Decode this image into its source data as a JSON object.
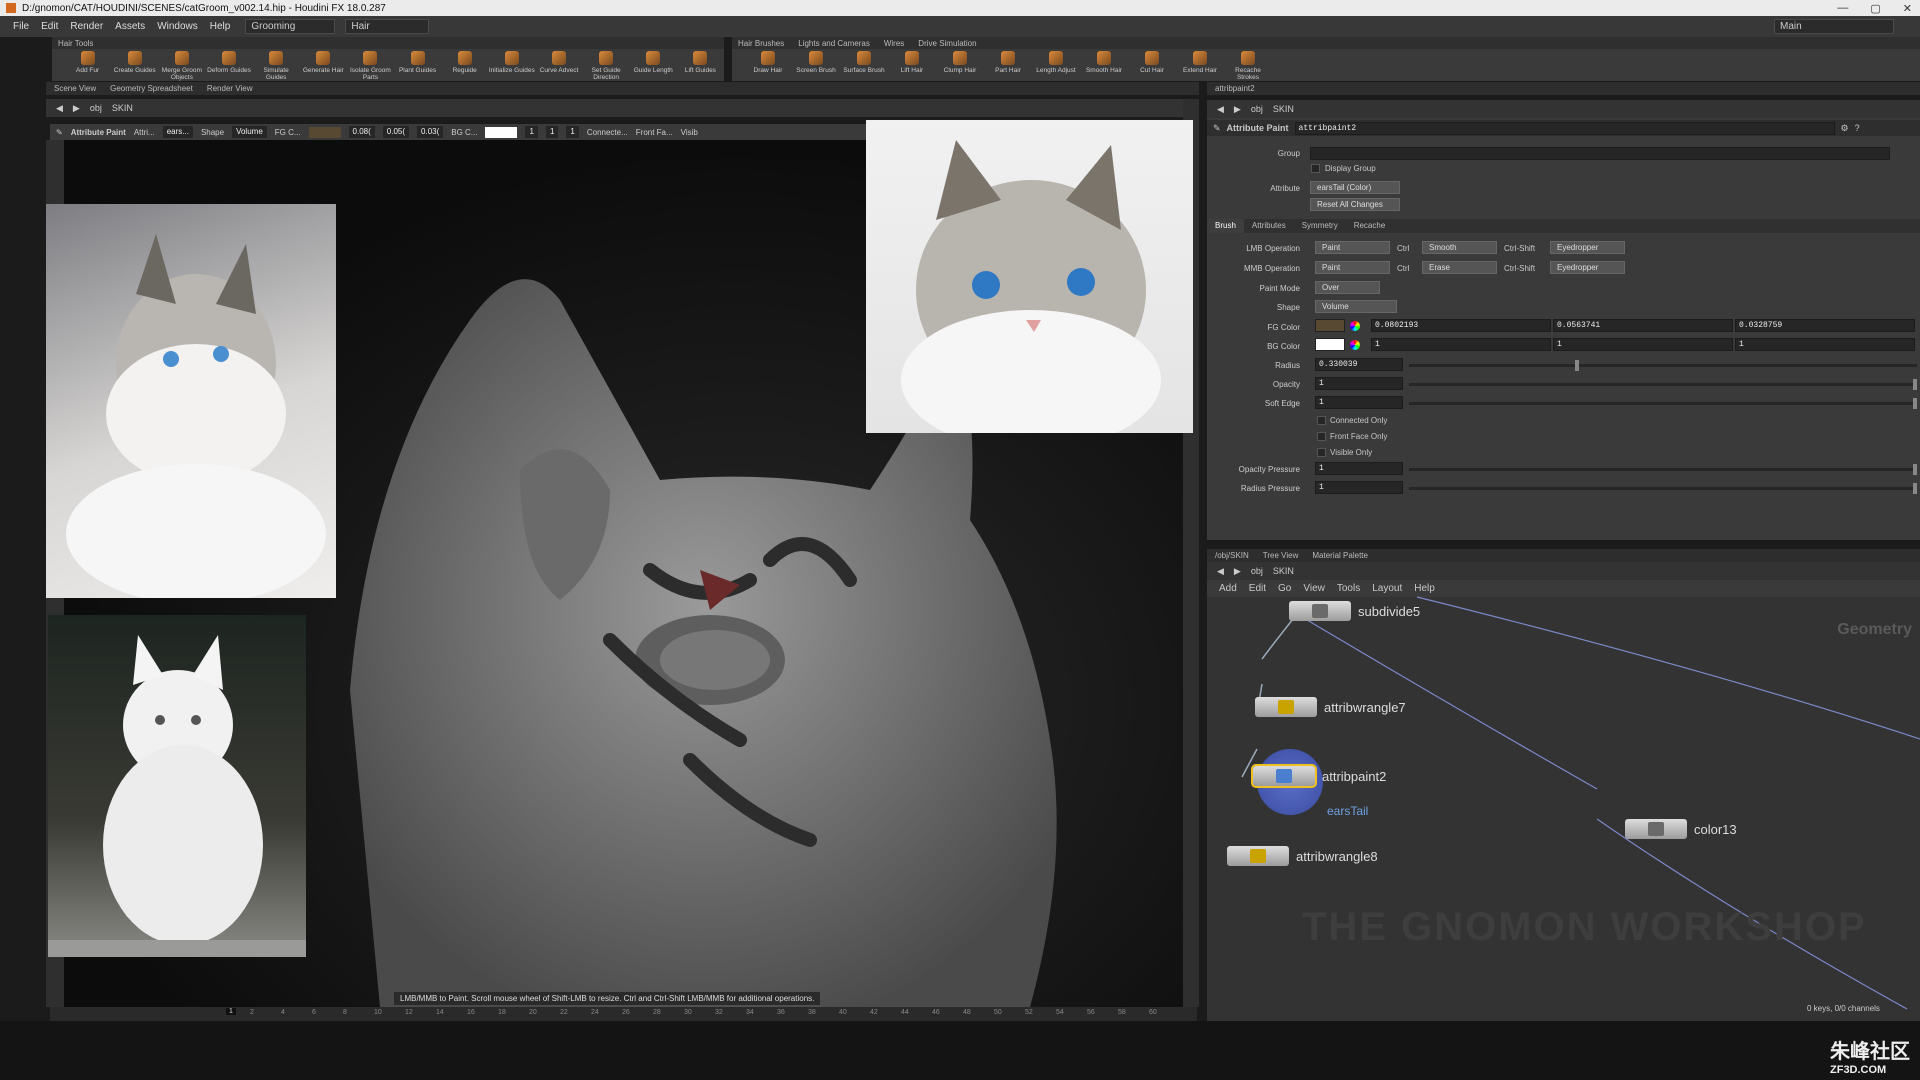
{
  "title_bar": {
    "text": "D:/gnomon/CAT/HOUDINI/SCENES/catGroom_v002.14.hip - Houdini FX 18.0.287",
    "controls": [
      "—",
      "▢",
      "✕"
    ]
  },
  "menu": {
    "items": [
      "File",
      "Edit",
      "Render",
      "Assets",
      "Windows",
      "Help"
    ],
    "desktop": "Grooming",
    "context": "Hair",
    "workspace": "Main"
  },
  "shelf_left": {
    "header": "Hair Tools",
    "tools": [
      "Add Fur",
      "Create Guides",
      "Merge Groom Objects",
      "Deform Guides",
      "Simulate Guides",
      "Generate Hair",
      "Isolate Groom Parts",
      "Plant Guides",
      "Reguide",
      "Initialize Guides",
      "Curve Advect",
      "Set Guide Direction",
      "Guide Length",
      "Lift Guides"
    ]
  },
  "shelf_right": {
    "tabs": [
      "Hair Brushes",
      "Lights and Cameras",
      "Wires",
      "Drive Simulation"
    ],
    "tools": [
      "Draw Hair",
      "Screen Brush",
      "Surface Brush",
      "Lift Hair",
      "Clump Hair",
      "Part Hair",
      "Length Adjust",
      "Smooth Hair",
      "Cut Hair",
      "Extend Hair",
      "Recache Strokes"
    ]
  },
  "viewport": {
    "tabs": [
      "Scene View",
      "Geometry Spreadsheet",
      "Render View"
    ],
    "path": {
      "root": "obj",
      "node": "SKIN"
    },
    "opbar": {
      "title": "Attribute Paint",
      "attr_short": "Attri...",
      "attr_dd": "ears...",
      "shape_label": "Shape",
      "shape": "Volume",
      "fg_label": "FG C...",
      "fg_vals": [
        "0.08(",
        "0.05(",
        "0.03("
      ],
      "bg_label": "BG C...",
      "bg_vals": [
        "1",
        "1",
        "1"
      ],
      "connected": "Connecte...",
      "front": "Front Fa...",
      "visible": "Visib"
    },
    "status": "LMB/MMB to Paint.  Scroll mouse wheel of Shift-LMB to resize.  Ctrl and Ctrl-Shift LMB/MMB for additional operations.",
    "frame": "1",
    "timeline_ticks": [
      "2",
      "4",
      "6",
      "8",
      "10",
      "12",
      "14",
      "16",
      "18",
      "20",
      "22",
      "24",
      "26",
      "28",
      "30",
      "32",
      "34",
      "36",
      "38",
      "40",
      "42",
      "44",
      "46",
      "48",
      "50",
      "52",
      "54",
      "56",
      "58",
      "60"
    ],
    "ref_photos": [
      "cat-photo-top-left",
      "cat-photo-bottom-left",
      "cat-photo-top-right"
    ]
  },
  "params": {
    "tab": "attribpaint2",
    "path": {
      "root": "obj",
      "node": "SKIN"
    },
    "node_type": "Attribute Paint",
    "node_name": "attribpaint2",
    "group_label": "Group",
    "display_group": "Display Group",
    "attribute_label": "Attribute",
    "attribute": "earsTail (Color)",
    "reset": "Reset All Changes",
    "subtabs": [
      "Brush",
      "Attributes",
      "Symmetry",
      "Recache"
    ],
    "lmb": {
      "label": "LMB Operation",
      "value": "Paint",
      "ctrl": "Ctrl",
      "ctrl_value": "Smooth",
      "ctrl_shift": "Ctrl-Shift",
      "ctrl_shift_value": "Eyedropper"
    },
    "mmb": {
      "label": "MMB Operation",
      "value": "Paint",
      "ctrl": "Ctrl",
      "ctrl_value": "Erase",
      "ctrl_shift": "Ctrl-Shift",
      "ctrl_shift_value": "Eyedropper"
    },
    "paint_mode": {
      "label": "Paint Mode",
      "value": "Over"
    },
    "shape": {
      "label": "Shape",
      "value": "Volume"
    },
    "fg": {
      "label": "FG Color",
      "values": [
        "0.0802193",
        "0.0563741",
        "0.0328759"
      ],
      "swatch": "#584a32"
    },
    "bg": {
      "label": "BG Color",
      "values": [
        "1",
        "1",
        "1"
      ],
      "swatch": "#ffffff"
    },
    "radius": {
      "label": "Radius",
      "value": "0.330039",
      "fraction": 0.33
    },
    "opacity": {
      "label": "Opacity",
      "value": "1",
      "fraction": 1
    },
    "soft_edge": {
      "label": "Soft Edge",
      "value": "1",
      "fraction": 1
    },
    "checks": [
      "Connected Only",
      "Front Face Only",
      "Visible Only"
    ],
    "opacity_pressure": {
      "label": "Opacity Pressure",
      "value": "1",
      "fraction": 1
    },
    "radius_pressure": {
      "label": "Radius Pressure",
      "value": "1",
      "fraction": 1
    }
  },
  "network": {
    "tabs": [
      "/obj/SKIN",
      "Tree View",
      "Material Palette"
    ],
    "path": {
      "root": "obj",
      "node": "SKIN"
    },
    "menu": [
      "Add",
      "Edit",
      "Go",
      "View",
      "Tools",
      "Layout",
      "Help"
    ],
    "context_label": "Geometry",
    "nodes": {
      "subdivide": "subdivide5",
      "wrangle7": "attribwrangle7",
      "paint": "attribpaint2",
      "paint_sub": "earsTail",
      "wrangle8": "attribwrangle8",
      "color": "color13"
    },
    "keys": "0 keys, 0/0 channels"
  },
  "watermark": {
    "text1": "朱峰社区",
    "text2": "ZF3D.COM",
    "gnomon": "THE GNOMON WORKSHOP"
  }
}
